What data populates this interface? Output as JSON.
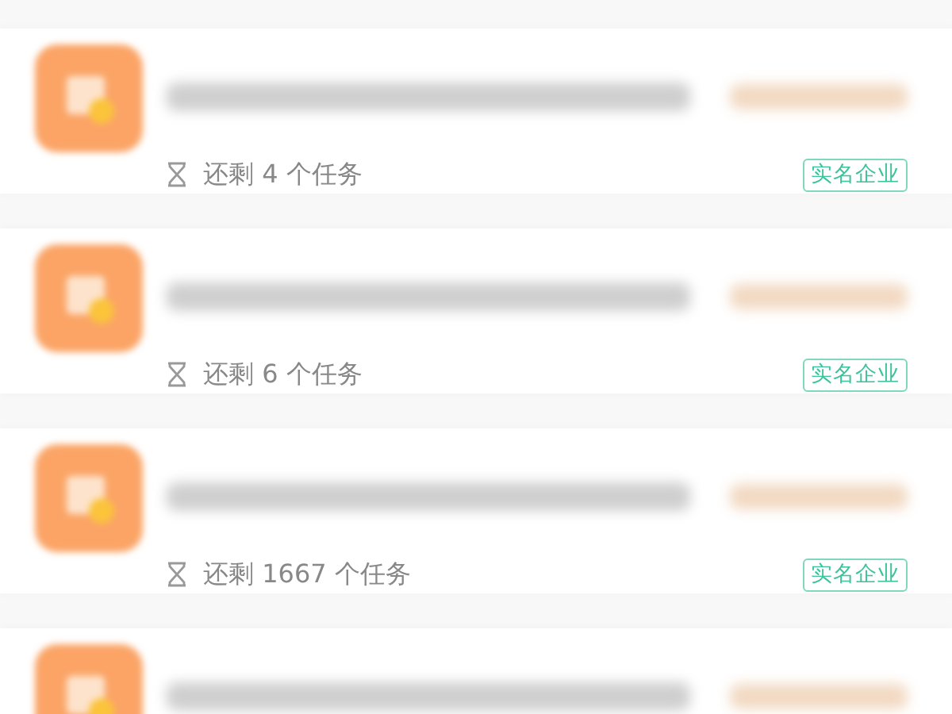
{
  "tasks": [
    {
      "kind": "task",
      "remaining": "还剩 4 个任务",
      "badge": "实名企业"
    },
    {
      "kind": "task",
      "remaining": "还剩 6 个任务",
      "badge": "实名企业"
    },
    {
      "kind": "task",
      "remaining": "还剩 1667 个任务",
      "badge": "实名企业"
    },
    {
      "kind": "task"
    }
  ]
}
